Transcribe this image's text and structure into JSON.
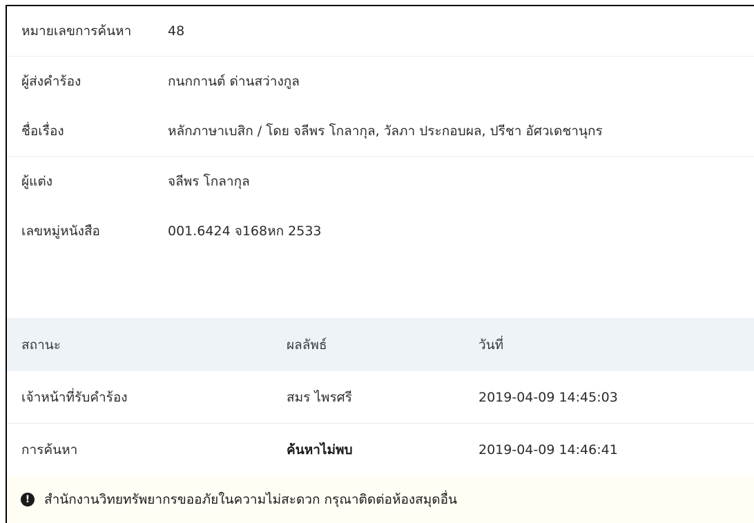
{
  "request": {
    "fields": [
      {
        "label": "หมายเลขการค้นหา",
        "value": "48"
      },
      {
        "label": "ผู้ส่งคำร้อง",
        "value": "กนกกานต์ ด่านสว่างกูล"
      },
      {
        "label": "ชื่อเรื่อง",
        "value": "หลักภาษาเบสิก / โดย จลีพร โกลากุล, วัลภา ประกอบผล, ปรีชา อัศวเดชานุกร"
      },
      {
        "label": "ผู้แต่ง",
        "value": "จลีพร โกลากุล"
      },
      {
        "label": "เลขหมู่หนังสือ",
        "value": "001.6424 จ168หก 2533"
      }
    ]
  },
  "status_table": {
    "headers": [
      "สถานะ",
      "ผลลัพธ์",
      "วันที่"
    ],
    "rows": [
      [
        "เจ้าหน้าที่รับคำร้อง",
        "สมร ไพรศรี",
        "2019-04-09 14:45:03"
      ],
      [
        "การค้นหา",
        "ค้นหาไม่พบ",
        "2019-04-09 14:46:41"
      ]
    ]
  },
  "notice": {
    "icon": "exclamation-circle-icon",
    "icon_glyph": "!",
    "text": "สำนักงานวิทยทรัพยากรขออภัยในความไม่สะดวก กรุณาติดต่อห้องสมุดอื่น"
  },
  "colors": {
    "header_bg": "#eef3f8",
    "notice_bg": "#fffdf4"
  }
}
